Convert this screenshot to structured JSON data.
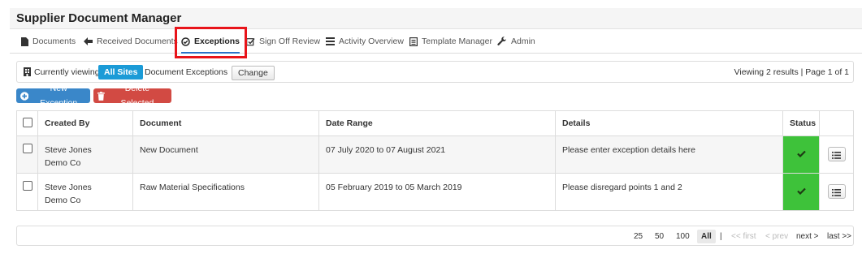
{
  "app": {
    "title": "Supplier Document Manager"
  },
  "nav": [
    {
      "label": "Documents",
      "icon": "document-icon"
    },
    {
      "label": "Received Documents",
      "icon": "arrow-left-icon"
    },
    {
      "label": "Exceptions",
      "icon": "check-circle-icon",
      "active": true
    },
    {
      "label": "Sign Off Review",
      "icon": "edit-check-icon"
    },
    {
      "label": "Activity Overview",
      "icon": "list-icon"
    },
    {
      "label": "Template Manager",
      "icon": "template-icon"
    },
    {
      "label": "Admin",
      "icon": "wrench-icon"
    }
  ],
  "viewbar": {
    "currently_viewing": "Currently viewing",
    "site": "All Sites",
    "context": "Document Exceptions",
    "change_label": "Change",
    "results": "Viewing 2 results | Page 1 of 1"
  },
  "actions": {
    "new_label": "New Exception",
    "delete_label": "Delete Selected"
  },
  "table": {
    "columns": [
      "Created By",
      "Document",
      "Date Range",
      "Details",
      "Status"
    ],
    "rows": [
      {
        "created_by": "Steve Jones",
        "company": "Demo Co",
        "document": "New Document",
        "date_range": "07 July 2020 to 07 August 2021",
        "details": "Please enter exception details here"
      },
      {
        "created_by": "Steve Jones",
        "company": "Demo Co",
        "document": "Raw Material Specifications",
        "date_range": "05 February 2019 to 05 March 2019",
        "details": "Please disregard points 1 and 2"
      }
    ]
  },
  "pager": {
    "sizes": [
      "25",
      "50",
      "100",
      "All"
    ],
    "separator": "|",
    "first": "<< first",
    "prev": "< prev",
    "next": "next >",
    "last": "last >>"
  },
  "colors": {
    "accent": "#1b9bd7",
    "new_button": "#3a87c9",
    "delete_button": "#d24a43",
    "status_ok": "#3ec23a",
    "highlight": "#e8141a"
  }
}
